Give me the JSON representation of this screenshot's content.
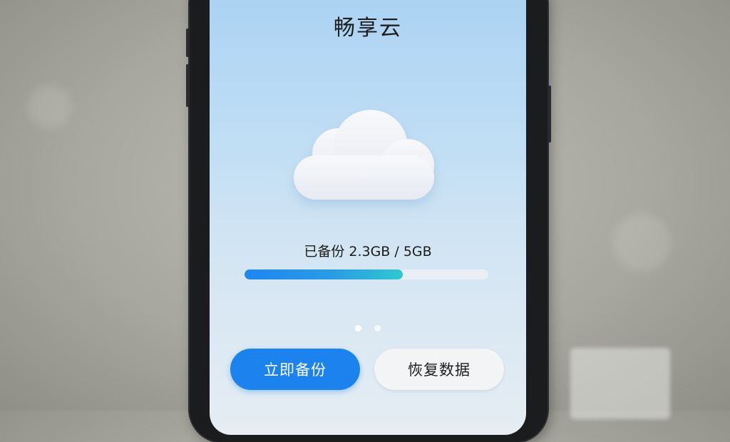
{
  "app": {
    "title": "畅享云"
  },
  "cloud": {
    "icon": "cloud-icon",
    "color": "#eef1f6"
  },
  "storage": {
    "label": "已备份 2.3GB / 5GB",
    "used_gb": 2.3,
    "total_gb": 5,
    "progress_fraction": 0.65
  },
  "pager": {
    "count": 2,
    "active_index": 0
  },
  "actions": {
    "backup_label": "立即备份",
    "restore_label": "恢复数据"
  },
  "colors": {
    "primary": "#1b82ee",
    "progress_start": "#1d86f1",
    "progress_end": "#2ec8cf",
    "secondary_button": "#f3f4f6"
  }
}
